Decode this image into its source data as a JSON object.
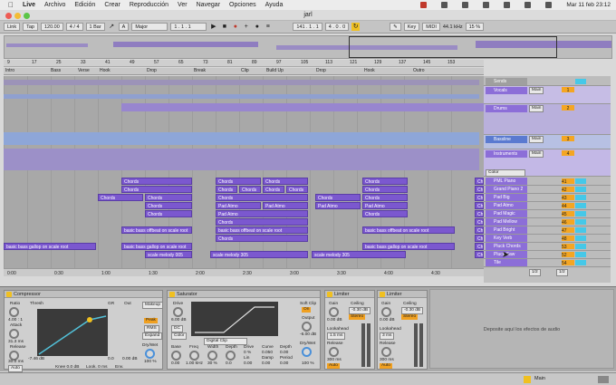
{
  "menubar": {
    "app": "Live",
    "items": [
      "Archivo",
      "Edición",
      "Crear",
      "Reproducción",
      "Ver",
      "Navegar",
      "Opciones",
      "Ayuda"
    ],
    "clock": "Mar 11 feb  23:12"
  },
  "window": {
    "title": "jarl"
  },
  "transport": {
    "link": "Link",
    "tap": "Tap",
    "tempo": "120.00",
    "meter": "4 / 4",
    "quant": "1 Bar",
    "key": "A",
    "scale": "Major",
    "pos1": "1 .  1 .  1",
    "arr_pos": "141 .  1 .  1",
    "loop_len": "4 .  0 .  0",
    "key_label": "Key",
    "midi_label": "MIDI",
    "sample_rate": "44.1 kHz",
    "cpu": "15 %"
  },
  "ruler": {
    "bars": [
      "9",
      "17",
      "25",
      "33",
      "41",
      "49",
      "57",
      "65",
      "73",
      "81",
      "89",
      "97",
      "105",
      "113",
      "121",
      "129",
      "137",
      "145",
      "153"
    ]
  },
  "locators": [
    "Intro",
    "Bass",
    "Verse",
    "Hook",
    "Drop",
    "Break",
    "Clip",
    "Build Up",
    "Drop",
    "Hook",
    "Outro"
  ],
  "clips": {
    "chords": "Chords",
    "pad": "Pad Atmo",
    "bass_offbeat": "basic bass offbeat on scale root",
    "bass_gallop": "basic bass gallop on scale root",
    "melody": "scale melody 005",
    "melody2": "scale melody 305",
    "chord_short": "Chor"
  },
  "tracks": [
    {
      "name": "Sends"
    },
    {
      "name": "Vocals",
      "out": "Main",
      "vol": "1"
    },
    {
      "name": "Drums",
      "out": "Main",
      "vol": "2"
    },
    {
      "name": "Bassline",
      "out": "Main",
      "vol": "3"
    },
    {
      "name": "Instruments",
      "out": "Main",
      "vol": "4"
    },
    {
      "name": "PML Piano",
      "vol": "41"
    },
    {
      "name": "Grand Piano 2",
      "vol": "42"
    },
    {
      "name": "Pad Big",
      "vol": "43"
    },
    {
      "name": "Pad Atmo",
      "vol": "44"
    },
    {
      "name": "Pad Magic",
      "vol": "45"
    },
    {
      "name": "Pad Mellow",
      "vol": "46"
    },
    {
      "name": "Pad Bright",
      "vol": "47"
    },
    {
      "name": "Key Verb",
      "vol": "48"
    },
    {
      "name": "Pluck Chords",
      "vol": "53"
    },
    {
      "name": "Pluck Saw",
      "vol": "52"
    },
    {
      "name": "Tile",
      "vol": "54"
    }
  ],
  "color_label": "Color",
  "timebar": [
    "0:00",
    "0:30",
    "1:00",
    "1:30",
    "2:00",
    "2:30",
    "3:00",
    "3:30",
    "4:00",
    "4:30"
  ],
  "bottom": {
    "page": "1/2",
    "rate": "1/2",
    "main": "Main"
  },
  "devices": {
    "compressor": {
      "name": "Compressor",
      "ratio_label": "Ratio",
      "ratio": "4.00 : 1",
      "attack_label": "Attack",
      "attack": "31.3 ms",
      "release_label": "Release",
      "release": "30.0 ms",
      "thresh_label": "Thresh",
      "thresh": "-7.46 dB",
      "gr_label": "GR",
      "out_label": "Out",
      "gr": "0.0",
      "out": "0.00 dB",
      "auto": "Auto",
      "knee": "Knee  0.0 dB",
      "look": "Look.  0 ms",
      "env": "Env.",
      "peak": "Peak",
      "rms": "RMS",
      "expand": "Expand",
      "drywet_label": "Dry/Wet",
      "drywet": "100 %",
      "makeup": "Makeup"
    },
    "saturator": {
      "name": "Saturator",
      "drive_label": "Drive",
      "drive": "6.00 dB",
      "dc": "DC",
      "color": "Color",
      "mode": "Digital Clip",
      "soft_clip": "Soft Clip",
      "soft_clip_state": "On",
      "output_label": "Output",
      "output": "-6.00 dB",
      "drywet_label": "Dry/Wet",
      "drywet": "100 %",
      "base_label": "Base",
      "base": "0.00",
      "freq_label": "Freq",
      "freq": "1.00 kHz",
      "width_label": "Width",
      "width": "30 %",
      "depth_label": "Depth",
      "depth": "0.0",
      "drive2_label": "Drive",
      "drive2": "0 %",
      "curve_label": "Curve",
      "curve": "0.050",
      "depth2_label": "Depth",
      "depth2": "0.00",
      "lin_label": "Lin",
      "lin": "0.00",
      "damp_label": "Damp",
      "damp": "0.00",
      "period_label": "Period",
      "period": "0.00"
    },
    "limiter1": {
      "name": "Limiter",
      "gain_label": "Gain",
      "gain": "0.00 dB",
      "ceiling_label": "Ceiling",
      "ceiling": "-0.30 dB",
      "stereo": "Stereo",
      "lookahead_label": "Lookahead",
      "lookahead": "1.5 ms",
      "release_label": "Release",
      "release": "300 ms",
      "auto": "Auto"
    },
    "limiter2": {
      "name": "Limiter",
      "gain_label": "Gain",
      "gain": "0.00 dB",
      "ceiling_label": "Ceiling",
      "ceiling": "-0.30 dB",
      "stereo": "Stereo",
      "lookahead_label": "Lookahead",
      "lookahead": "3 ms",
      "release_label": "Release",
      "release": "300 ms",
      "auto": "Auto"
    },
    "dropzone": "Deposite aquí los efectos de audio"
  },
  "status": {
    "main": "Main"
  },
  "colors": {
    "clip": "#7b58cf",
    "accent": "#f4a623",
    "blue": "#46c8e8"
  }
}
